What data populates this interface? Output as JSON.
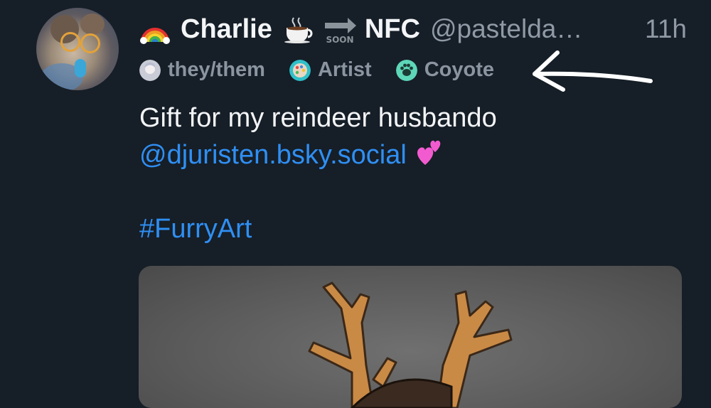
{
  "post": {
    "author": {
      "display_name": "Charlie",
      "name_suffix": "NFC",
      "handle": "@pastelda…",
      "timestamp": "11h"
    },
    "badges": [
      {
        "label": "they/them",
        "icon": "character-avatar-icon"
      },
      {
        "label": "Artist",
        "icon": "palette-icon"
      },
      {
        "label": "Coyote",
        "icon": "paw-icon"
      }
    ],
    "text": {
      "line1": "Gift for my reindeer husbando",
      "mention": "@djuristen.bsky.social",
      "hashtag": "#FurryArt"
    },
    "emoji": {
      "rainbow": "rainbow-emoji",
      "coffee": "hot-beverage-emoji",
      "soon": "soon-arrow-emoji",
      "heart": "two-hearts-emoji"
    },
    "soon_label": "SOON",
    "colors": {
      "background": "#161e27",
      "link": "#2f8ff3",
      "muted": "#8f9aa6",
      "text": "#f3f5f7"
    }
  }
}
